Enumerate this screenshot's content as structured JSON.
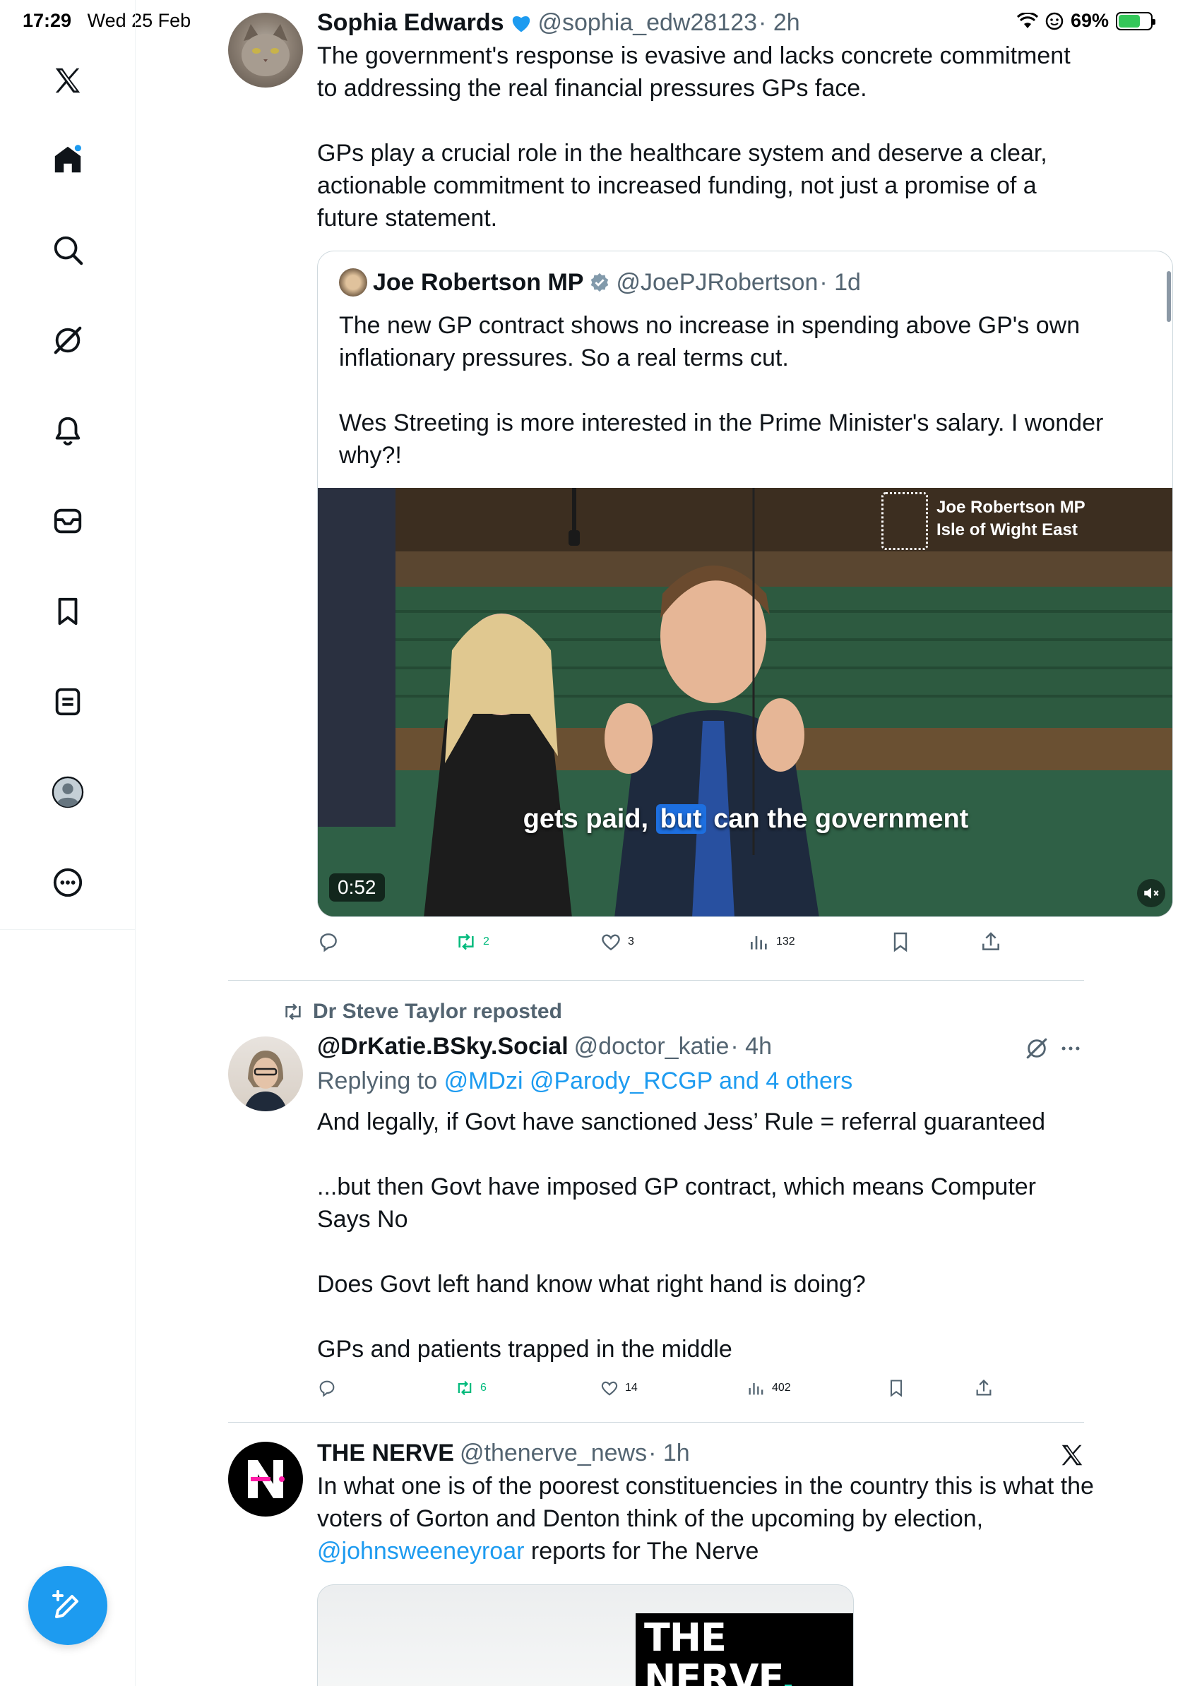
{
  "status_bar": {
    "time": "17:29",
    "date": "Wed 25 Feb",
    "battery": "69%",
    "battery_level": 0.69
  },
  "sidebar": {
    "items": [
      {
        "name": "x-logo-icon"
      },
      {
        "name": "home-icon"
      },
      {
        "name": "search-icon"
      },
      {
        "name": "grok-icon"
      },
      {
        "name": "notifications-icon"
      },
      {
        "name": "messages-icon"
      },
      {
        "name": "bookmarks-icon"
      },
      {
        "name": "lists-icon"
      },
      {
        "name": "profile-icon"
      },
      {
        "name": "more-icon"
      }
    ],
    "compose_icon": "compose-icon"
  },
  "post1": {
    "display_name": "Sophia Edwards",
    "handle": "@sophia_edw28123",
    "time": "· 2h",
    "text": "The government's response is evasive and lacks concrete commitment to addressing the real financial pressures GPs face.\n\nGPs play a crucial role in the healthcare system and deserve a clear, actionable commitment to increased funding, not just a promise of a future statement.",
    "quote": {
      "display_name": "Joe Robertson MP",
      "handle": "@JoePJRobertson",
      "time": "· 1d",
      "text": "The new GP contract shows no increase in spending above GP's own inflationary pressures. So a real terms cut.\n\nWes Streeting is more interested in the Prime Minister's salary. I wonder why?!",
      "video": {
        "overlay_name": "Joe Robertson MP",
        "overlay_constituency": "Isle of Wight East",
        "caption_before": "gets paid,",
        "caption_highlight": "but",
        "caption_after": "can the government",
        "duration": "0:52"
      }
    },
    "actions": {
      "replies": "",
      "reposts": "2",
      "likes": "3",
      "views": "132"
    }
  },
  "post2": {
    "repost_label": "Dr Steve Taylor reposted",
    "display_name": "@DrKatie.BSky.Social",
    "handle": "@doctor_katie",
    "time": "· 4h",
    "replying_prefix": "Replying to",
    "replying_to": "@MDzi @Parody_RCGP and 4 others",
    "text": "And legally, if Govt have sanctioned Jess’ Rule = referral guaranteed\n\n...but then Govt have imposed GP contract, which means Computer Says No\n\nDoes Govt left hand know what right hand is doing?\n\nGPs and patients trapped in the middle",
    "actions": {
      "replies": "",
      "reposts": "6",
      "likes": "14",
      "views": "402"
    }
  },
  "post3": {
    "display_name": "THE NERVE",
    "handle": "@thenerve_news",
    "time": "· 1h",
    "text_before": "In what one is of the poorest constituencies in the country this is what the voters of Gorton and Denton think of the upcoming by election, ",
    "mention": "@johnsweeneyroar",
    "text_after": " reports for The Nerve",
    "media_logo": "THE NERVE"
  },
  "colors": {
    "accent": "#1d9bf0",
    "repost_green": "#00ba7c",
    "secondary_text": "#536471"
  }
}
